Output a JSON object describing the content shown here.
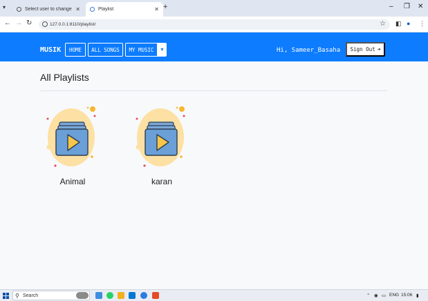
{
  "browser": {
    "tabs": [
      {
        "title": "Select user to change | Django",
        "active": false
      },
      {
        "title": "Playlist",
        "active": true
      }
    ],
    "url": "127.0.0.1:8110/playlist/"
  },
  "navbar": {
    "brand": "MUSIK",
    "links": [
      "HOME",
      "ALL SONGS",
      "MY MUSIC"
    ],
    "greeting": "Hi, Sameer_Basaha",
    "signout": "Sign Out",
    "accent": "#0d7cff"
  },
  "main": {
    "title": "All Playlists",
    "playlists": [
      {
        "name": "Animal",
        "icon": "playlist-icon"
      },
      {
        "name": "karan",
        "icon": "playlist-icon"
      }
    ]
  },
  "taskbar": {
    "search": "Search",
    "language": "ENG",
    "time": "15:06"
  }
}
